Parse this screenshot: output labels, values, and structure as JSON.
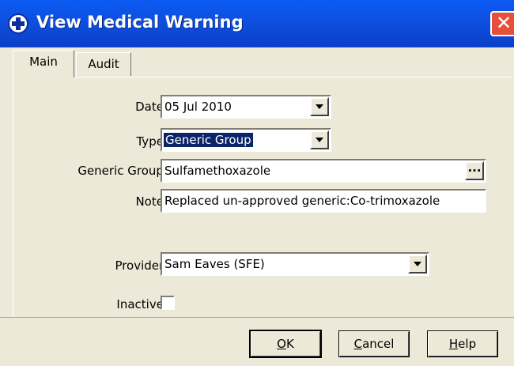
{
  "window": {
    "title": "View Medical Warning",
    "close_glyph": "✕"
  },
  "tabs": [
    {
      "label": "Main",
      "active": true
    },
    {
      "label": "Audit",
      "active": false
    }
  ],
  "form": {
    "date": {
      "label": "Date:",
      "value": "05 Jul 2010"
    },
    "type": {
      "label": "Type:",
      "value": "Generic Group"
    },
    "generic_group": {
      "label": "Generic Group:",
      "value": "Sulfamethoxazole",
      "button": "..."
    },
    "note": {
      "label": "Note:",
      "value": "Replaced un-approved generic:Co-trimoxazole"
    },
    "provider": {
      "label": "Provider:",
      "value": "Sam Eaves (SFE)"
    },
    "inactive": {
      "label": "Inactive:",
      "checked": false
    }
  },
  "buttons": {
    "ok": {
      "mnemonic": "O",
      "rest": "K"
    },
    "cancel": {
      "mnemonic": "C",
      "rest": "ancel"
    },
    "help": {
      "mnemonic": "H",
      "rest": "elp"
    }
  },
  "colors": {
    "titlebar": "#0a4fe0",
    "dialog_face": "#ece9d8",
    "selection": "#0a246a",
    "close_button": "#e6503a"
  },
  "icons": {
    "app": "medical-cross-icon",
    "close": "close-icon",
    "dropdown": "chevron-down-icon"
  }
}
